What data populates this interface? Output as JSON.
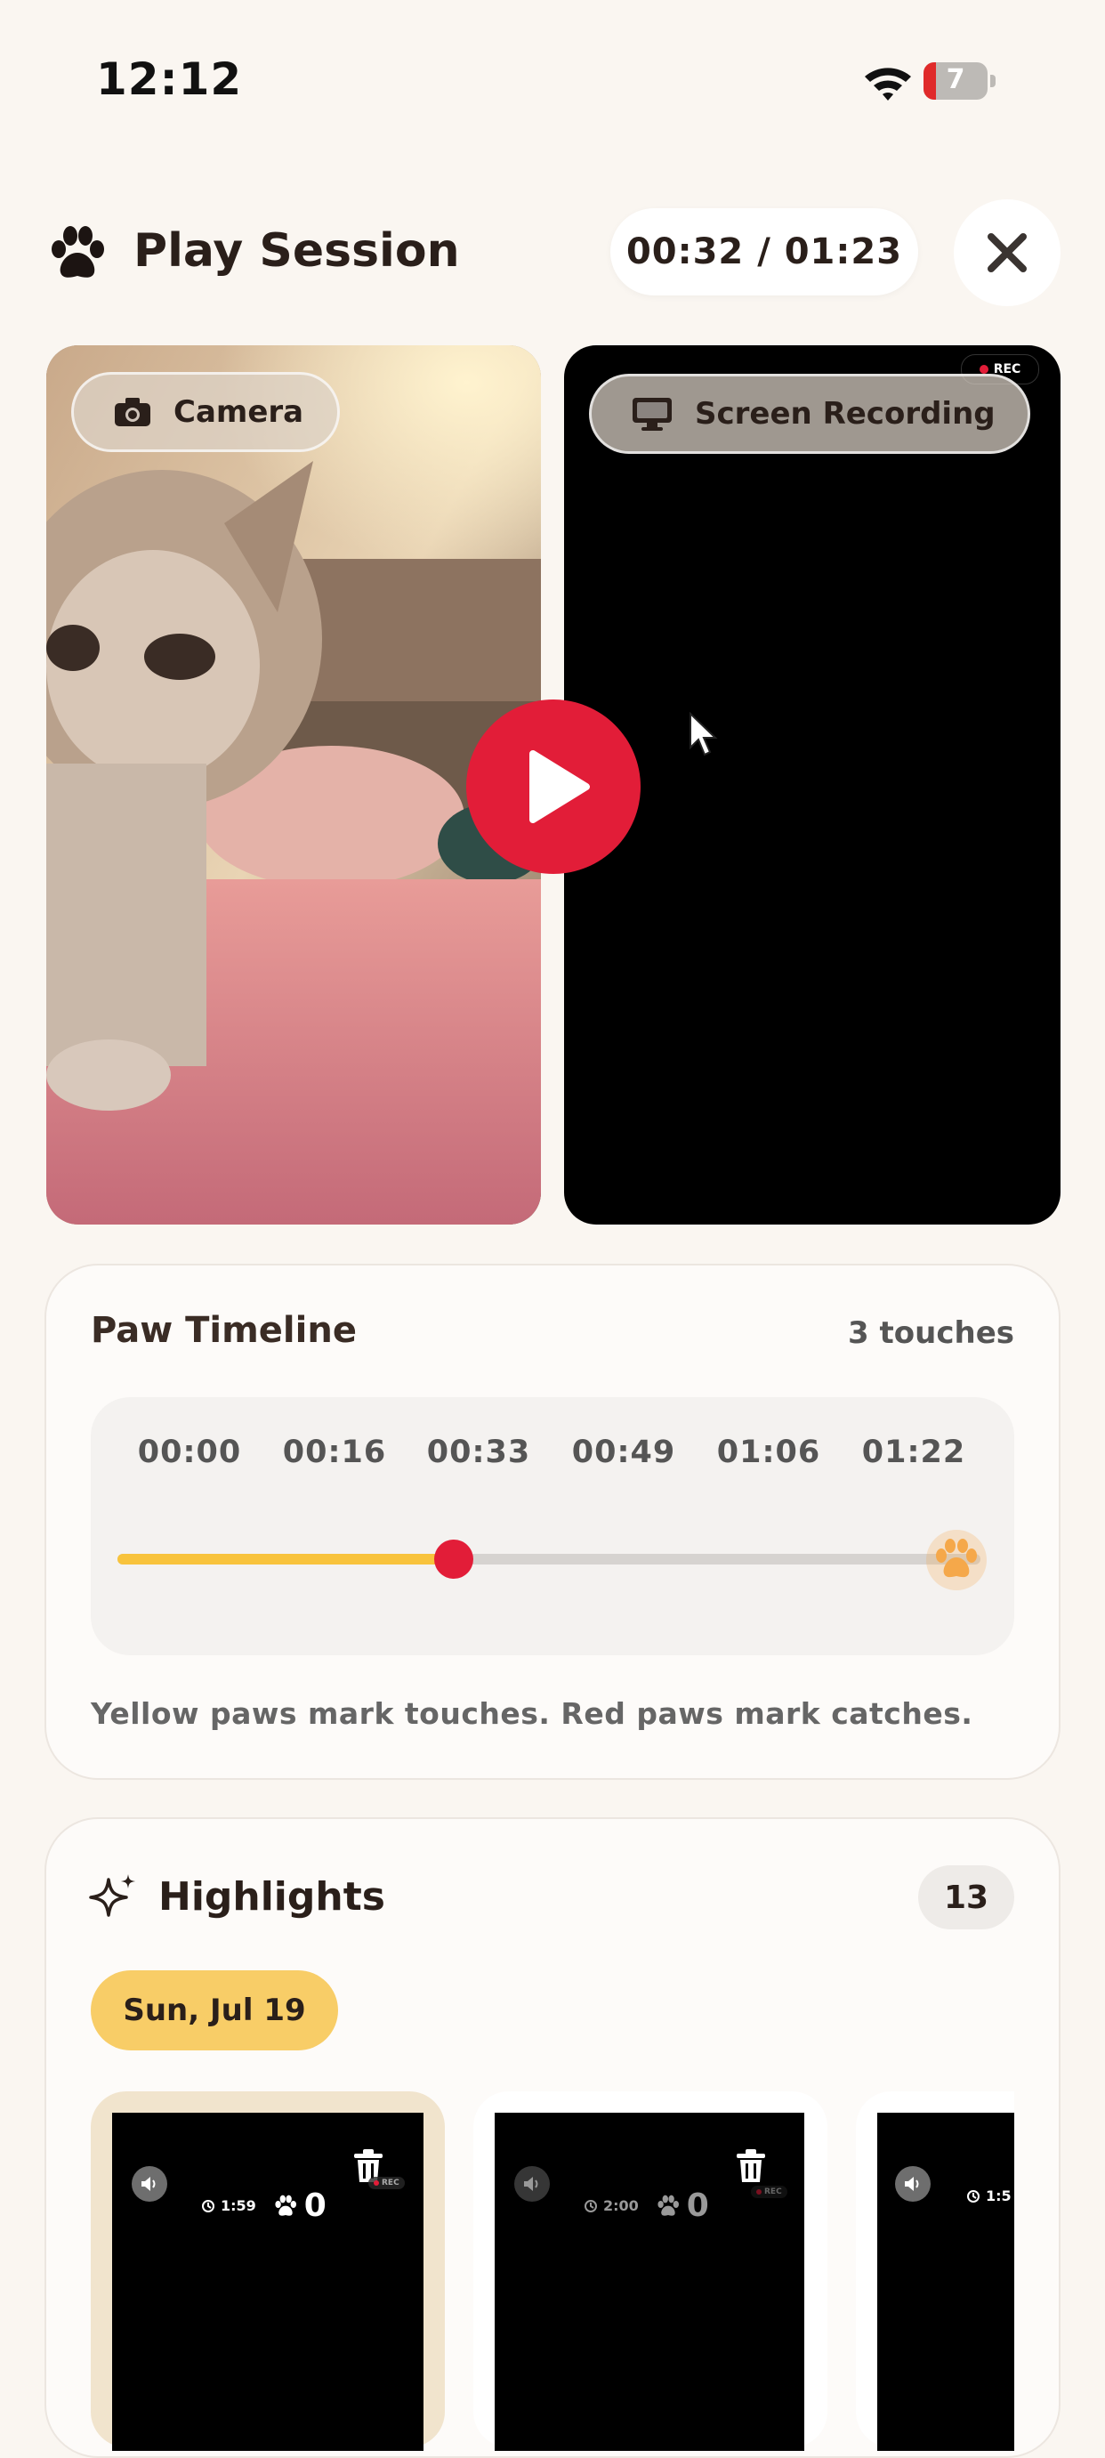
{
  "status_bar": {
    "time": "12:12",
    "battery": "7"
  },
  "header": {
    "title": "Play Session",
    "time_progress": "00:32 / 01:23"
  },
  "video": {
    "camera_label": "Camera",
    "screen_label": "Screen Recording",
    "rec_badge": "REC"
  },
  "timeline": {
    "title": "Paw Timeline",
    "count": "3 touches",
    "ticks": [
      "00:00",
      "00:16",
      "00:33",
      "00:49",
      "01:06",
      "01:22"
    ],
    "progress_fraction": 0.39,
    "note": "Yellow paws mark touches. Red paws mark catches."
  },
  "highlights": {
    "title": "Highlights",
    "count": "13",
    "date": "Sun, Jul 19",
    "clips": [
      {
        "duration": "1:59",
        "catches": "0",
        "rec": "REC"
      },
      {
        "duration": "2:00",
        "catches": "0",
        "rec": "REC"
      },
      {
        "duration": "1:5",
        "catches": "",
        "rec": ""
      }
    ]
  },
  "colors": {
    "background": "#faf6f1",
    "accent_red": "#e21d38",
    "touch_yellow": "#f8c33c",
    "paw_orange": "#f5a84a",
    "date_chip": "#f8cd67"
  }
}
